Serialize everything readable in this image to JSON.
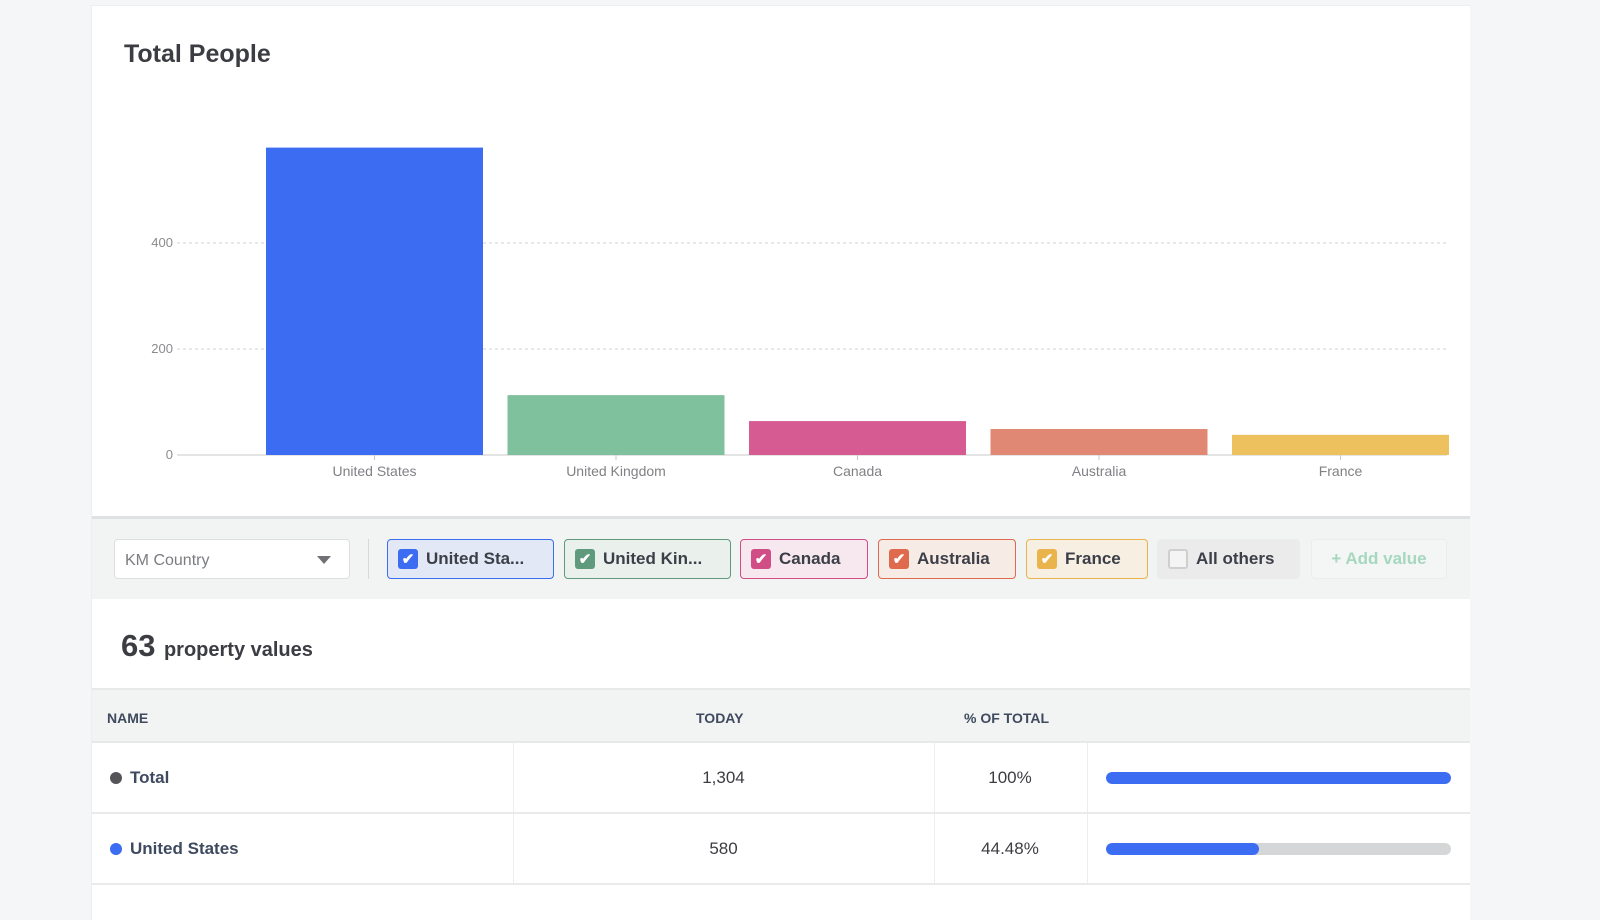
{
  "panel": {
    "title": "Total People"
  },
  "chart_data": {
    "type": "bar",
    "title": "Total People",
    "xlabel": "",
    "ylabel": "",
    "categories": [
      "United States",
      "United Kingdom",
      "Canada",
      "Australia",
      "France"
    ],
    "values": [
      580,
      113,
      64,
      49,
      38
    ],
    "colors": [
      "#3b6cf2",
      "#80c19d",
      "#d65b93",
      "#e08873",
      "#edc25e"
    ],
    "yticks": [
      0,
      200,
      400
    ],
    "ylim": [
      0,
      600
    ],
    "grid": true,
    "legend": "none"
  },
  "filter": {
    "property_select": "KM Country",
    "chips": [
      {
        "label": "United Sta...",
        "checked": true,
        "color": "#3b6cf2",
        "bg": "#e3e8f7"
      },
      {
        "label": "United Kin...",
        "checked": true,
        "color": "#5f9a7d",
        "bg": "#eaf0ec"
      },
      {
        "label": "Canada",
        "checked": true,
        "color": "#d04d86",
        "bg": "#f6e8ee"
      },
      {
        "label": "Australia",
        "checked": true,
        "color": "#e06a4d",
        "bg": "#f7ebe6"
      },
      {
        "label": "France",
        "checked": true,
        "color": "#eab44c",
        "bg": "#f6efe2"
      },
      {
        "label": "All others",
        "checked": false
      }
    ],
    "add_value_label": "+ Add value"
  },
  "summary": {
    "count": "63",
    "label": "property values"
  },
  "table": {
    "headers": [
      "NAME",
      "TODAY",
      "% OF TOTAL"
    ],
    "rows": [
      {
        "name": "Total",
        "dot_color": "#555459",
        "today": "1,304",
        "pct": "100%",
        "fraction": 1.0
      },
      {
        "name": "United States",
        "dot_color": "#3b6cf2",
        "today": "580",
        "pct": "44.48%",
        "fraction": 0.4448
      }
    ]
  }
}
